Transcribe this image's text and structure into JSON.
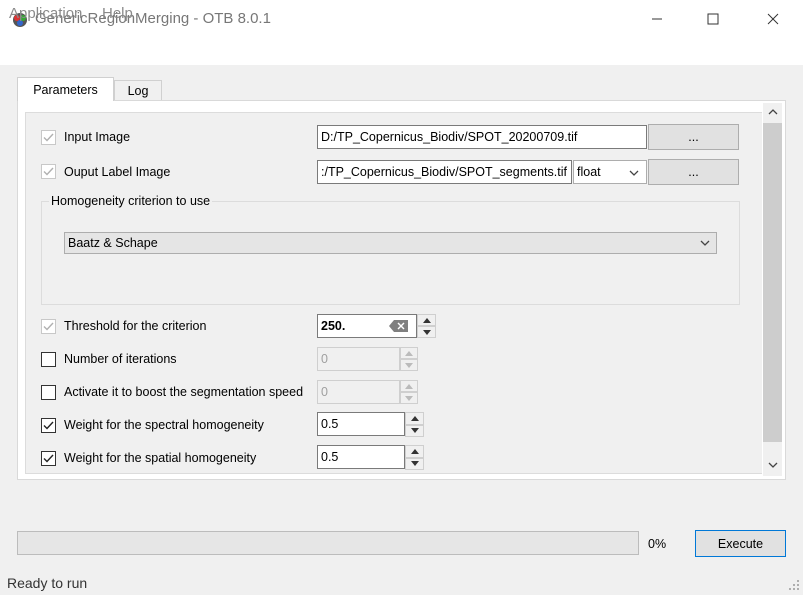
{
  "window": {
    "title": "GenericRegionMerging - OTB 8.0.1"
  },
  "menu": {
    "application": "Application",
    "help": "Help"
  },
  "tabs": {
    "parameters": "Parameters",
    "log": "Log"
  },
  "params": {
    "input_image": {
      "label": "Input Image",
      "value": "D:/TP_Copernicus_Biodiv/SPOT_20200709.tif",
      "browse": "...",
      "checked": true
    },
    "output_image": {
      "label": "Ouput Label Image",
      "value": ":/TP_Copernicus_Biodiv/SPOT_segments.tif",
      "type": "float",
      "browse": "...",
      "checked": true
    },
    "criterion_group": {
      "title": "Homogeneity criterion to use",
      "selected": "Baatz & Schape"
    },
    "threshold": {
      "label": "Threshold for the criterion",
      "value": "250.",
      "checked": true
    },
    "iterations": {
      "label": "Number of iterations",
      "value": "0",
      "checked": false
    },
    "speed": {
      "label": "Activate it to boost the segmentation speed",
      "value": "0",
      "checked": false
    },
    "spectral": {
      "label": "Weight for the spectral homogeneity",
      "value": "0.5",
      "checked": true
    },
    "spatial": {
      "label": "Weight for the spatial homogeneity",
      "value": "0.5",
      "checked": true
    }
  },
  "progress": {
    "value": 0,
    "text": "0%"
  },
  "execute_label": "Execute",
  "status": "Ready to run"
}
